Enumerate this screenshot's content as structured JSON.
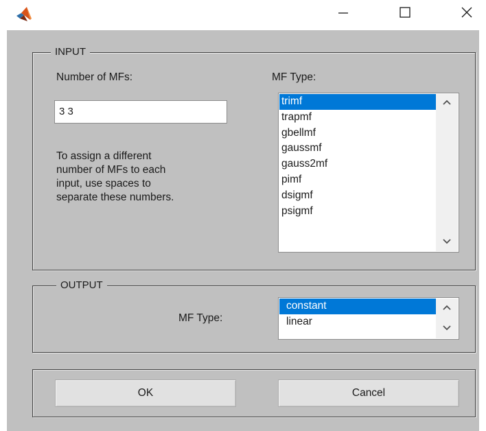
{
  "window": {
    "app_icon": "matlab-logo-icon",
    "controls": {
      "minimize_icon": "minimize-icon",
      "maximize_icon": "maximize-icon",
      "close_icon": "close-icon"
    }
  },
  "input": {
    "legend": "INPUT",
    "num_mfs_label": "Number of MFs:",
    "num_mfs_value": "3 3",
    "hint_lines": [
      "To assign a different",
      "number of MFs to each",
      "input, use spaces to",
      "separate these numbers."
    ],
    "mf_type_label": "MF Type:",
    "mf_types": [
      "trimf",
      "trapmf",
      "gbellmf",
      "gaussmf",
      "gauss2mf",
      "pimf",
      "dsigmf",
      "psigmf"
    ],
    "selected_mf_type": "trimf"
  },
  "output": {
    "legend": "OUTPUT",
    "mf_type_label": "MF Type:",
    "mf_types": [
      "constant",
      "linear"
    ],
    "selected_mf_type": "constant"
  },
  "buttons": {
    "ok_label": "OK",
    "cancel_label": "Cancel"
  },
  "colors": {
    "selection": "#0078d7",
    "dialog_background": "#c0c0c0"
  }
}
